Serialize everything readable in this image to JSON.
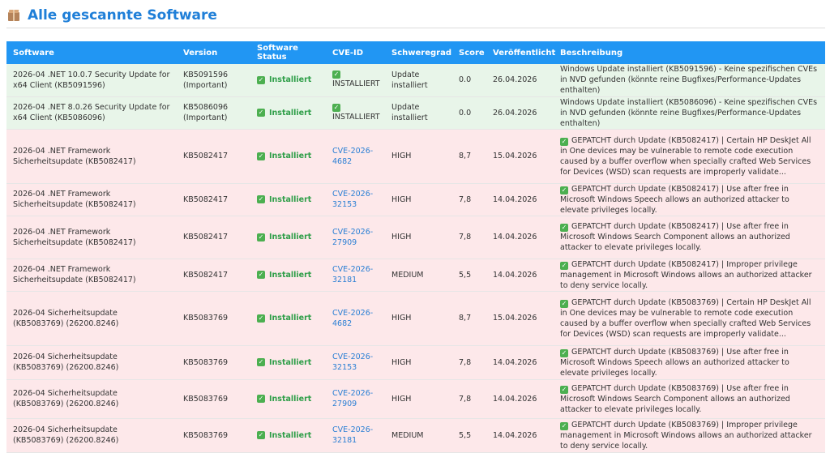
{
  "page": {
    "title": "Alle gescannte Software",
    "icon": "package-box-icon"
  },
  "colors": {
    "accent": "#2196f3",
    "title": "#1f7fd8",
    "installed_row": "#e8f5e9",
    "vuln_row": "#fde8ea",
    "status_green": "#2e9e48",
    "link": "#2a7fd4"
  },
  "table": {
    "headers": [
      "Software",
      "Version",
      "Software Status",
      "CVE-ID",
      "Schweregrad",
      "Score",
      "Veröffentlicht",
      "Beschreibung"
    ],
    "rows": [
      {
        "type": "green",
        "software": "2026-04 .NET 10.0.7 Security Update for x64 Client (KB5091596)",
        "version": "KB5091596 (Important)",
        "status": "Installiert",
        "cve": "INSTALLIERT",
        "cve_is_link": false,
        "severity": "Update installiert",
        "score": "0.0",
        "published": "26.04.2026",
        "description": "Windows Update installiert (KB5091596) - Keine spezifischen CVEs in NVD gefunden (könnte reine Bugfixes/Performance-Updates enthalten)",
        "desc_check": false,
        "h": 40
      },
      {
        "type": "green",
        "software": "2026-04 .NET 8.0.26 Security Update for x64 Client (KB5086096)",
        "version": "KB5086096 (Important)",
        "status": "Installiert",
        "cve": "INSTALLIERT",
        "cve_is_link": false,
        "severity": "Update installiert",
        "score": "0.0",
        "published": "26.04.2026",
        "description": "Windows Update installiert (KB5086096) - Keine spezifischen CVEs in NVD gefunden (könnte reine Bugfixes/Performance-Updates enthalten)",
        "desc_check": false,
        "h": 39
      },
      {
        "type": "red",
        "software": "2026-04 .NET Framework Sicherheitsupdate (KB5082417)",
        "version": "KB5082417",
        "status": "Installiert",
        "cve": "CVE-2026-4682",
        "cve_is_link": true,
        "severity": "HIGH",
        "score": "8,7",
        "published": "15.04.2026",
        "description": "GEPATCHT durch Update (KB5082417) | Certain HP DeskJet All in One devices may be vulnerable to remote code execution caused by a buffer overflow when specially crafted Web Services for Devices (WSD) scan requests are improperly validate...",
        "desc_check": true,
        "h": 67
      },
      {
        "type": "red",
        "software": "2026-04 .NET Framework Sicherheitsupdate (KB5082417)",
        "version": "KB5082417",
        "status": "Installiert",
        "cve": "CVE-2026-32153",
        "cve_is_link": true,
        "severity": "HIGH",
        "score": "7,8",
        "published": "14.04.2026",
        "description": "GEPATCHT durch Update (KB5082417) | Use after free in Microsoft Windows Speech allows an authorized attacker to elevate privileges locally.",
        "desc_check": true,
        "h": 37
      },
      {
        "type": "red",
        "software": "2026-04 .NET Framework Sicherheitsupdate (KB5082417)",
        "version": "KB5082417",
        "status": "Installiert",
        "cve": "CVE-2026-27909",
        "cve_is_link": true,
        "severity": "HIGH",
        "score": "7,8",
        "published": "14.04.2026",
        "description": "GEPATCHT durch Update (KB5082417) | Use after free in Microsoft Windows Search Component allows an authorized attacker to elevate privileges locally.",
        "desc_check": true,
        "h": 53
      },
      {
        "type": "red",
        "software": "2026-04 .NET Framework Sicherheitsupdate (KB5082417)",
        "version": "KB5082417",
        "status": "Installiert",
        "cve": "CVE-2026-32181",
        "cve_is_link": true,
        "severity": "MEDIUM",
        "score": "5,5",
        "published": "14.04.2026",
        "description": "GEPATCHT durch Update (KB5082417) | Improper privilege management in Microsoft Windows allows an authorized attacker to deny service locally.",
        "desc_check": true,
        "h": 40
      },
      {
        "type": "red",
        "software": "2026-04 Sicherheitsupdate (KB5083769) (26200.8246)",
        "version": "KB5083769",
        "status": "Installiert",
        "cve": "CVE-2026-4682",
        "cve_is_link": true,
        "severity": "HIGH",
        "score": "8,7",
        "published": "15.04.2026",
        "description": "GEPATCHT durch Update (KB5083769) | Certain HP DeskJet All in One devices may be vulnerable to remote code execution caused by a buffer overflow when specially crafted Web Services for Devices (WSD) scan requests are improperly validate...",
        "desc_check": true,
        "h": 67
      },
      {
        "type": "red",
        "software": "2026-04 Sicherheitsupdate (KB5083769) (26200.8246)",
        "version": "KB5083769",
        "status": "Installiert",
        "cve": "CVE-2026-32153",
        "cve_is_link": true,
        "severity": "HIGH",
        "score": "7,8",
        "published": "14.04.2026",
        "description": "GEPATCHT durch Update (KB5083769) | Use after free in Microsoft Windows Speech allows an authorized attacker to elevate privileges locally.",
        "desc_check": true,
        "h": 42
      },
      {
        "type": "red",
        "software": "2026-04 Sicherheitsupdate (KB5083769) (26200.8246)",
        "version": "KB5083769",
        "status": "Installiert",
        "cve": "CVE-2026-27909",
        "cve_is_link": true,
        "severity": "HIGH",
        "score": "7,8",
        "published": "14.04.2026",
        "description": "GEPATCHT durch Update (KB5083769) | Use after free in Microsoft Windows Search Component allows an authorized attacker to elevate privileges locally.",
        "desc_check": true,
        "h": 48
      },
      {
        "type": "red",
        "software": "2026-04 Sicherheitsupdate (KB5083769) (26200.8246)",
        "version": "KB5083769",
        "status": "Installiert",
        "cve": "CVE-2026-32181",
        "cve_is_link": true,
        "severity": "MEDIUM",
        "score": "5,5",
        "published": "14.04.2026",
        "description": "GEPATCHT durch Update (KB5083769) | Improper privilege management in Microsoft Windows allows an authorized attacker to deny service locally.",
        "desc_check": true,
        "h": 42
      }
    ]
  }
}
